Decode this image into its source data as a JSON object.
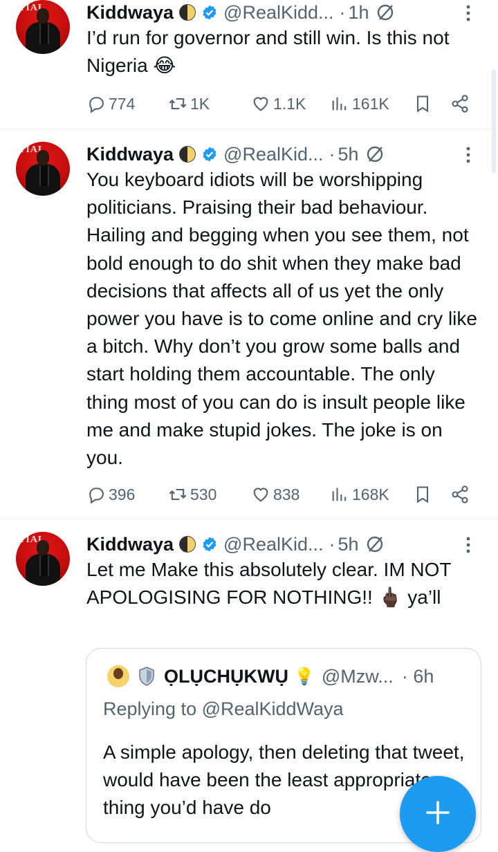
{
  "tweets": [
    {
      "name": "Kiddwaya",
      "handle": "@RealKidd...",
      "time": "1h",
      "text": "I’d run for governor and still win. Is this not Nigeria 😂",
      "replies": "774",
      "retweets": "1K",
      "likes": "1.1K",
      "views": "161K"
    },
    {
      "name": "Kiddwaya",
      "handle": "@RealKid...",
      "time": "5h",
      "text": "You keyboard idiots will be worshipping politicians. Praising their bad behaviour. Hailing and begging when you see them, not bold enough to do shit when they make bad decisions that affects all of us yet the only power you have is to come online and cry like a bitch. Why don’t you grow some balls and start holding them accountable. The only thing most of you can do is insult people like me and make stupid jokes. The joke is on you.",
      "replies": "396",
      "retweets": "530",
      "likes": "838",
      "views": "168K"
    },
    {
      "name": "Kiddwaya",
      "handle": "@RealKid...",
      "time": "5h",
      "text": "Let me Make this absolutely clear. IM NOT APOLOGISING FOR NOTHING!! 🖕🏿 ya’ll"
    }
  ],
  "quote": {
    "name": "ỌLỤCHỤKWỤ",
    "bulb": "💡",
    "handle": "@Mzw...",
    "time": "6h",
    "replying": "Replying to @RealKiddWaya",
    "text": "A simple apology, then deleting that tweet, would have been the least appropriate thing you’d have do"
  },
  "separator": "·",
  "colors": {
    "accent": "#1d9bf0",
    "muted": "#536471",
    "verified": "#1d9bf0",
    "avatar_bg": "#c60d0d"
  },
  "icons": [
    "reply-icon",
    "retweet-icon",
    "like-icon",
    "views-icon",
    "bookmark-icon",
    "share-icon",
    "grok-icon",
    "more-icon",
    "verified-icon",
    "compose-icon"
  ]
}
